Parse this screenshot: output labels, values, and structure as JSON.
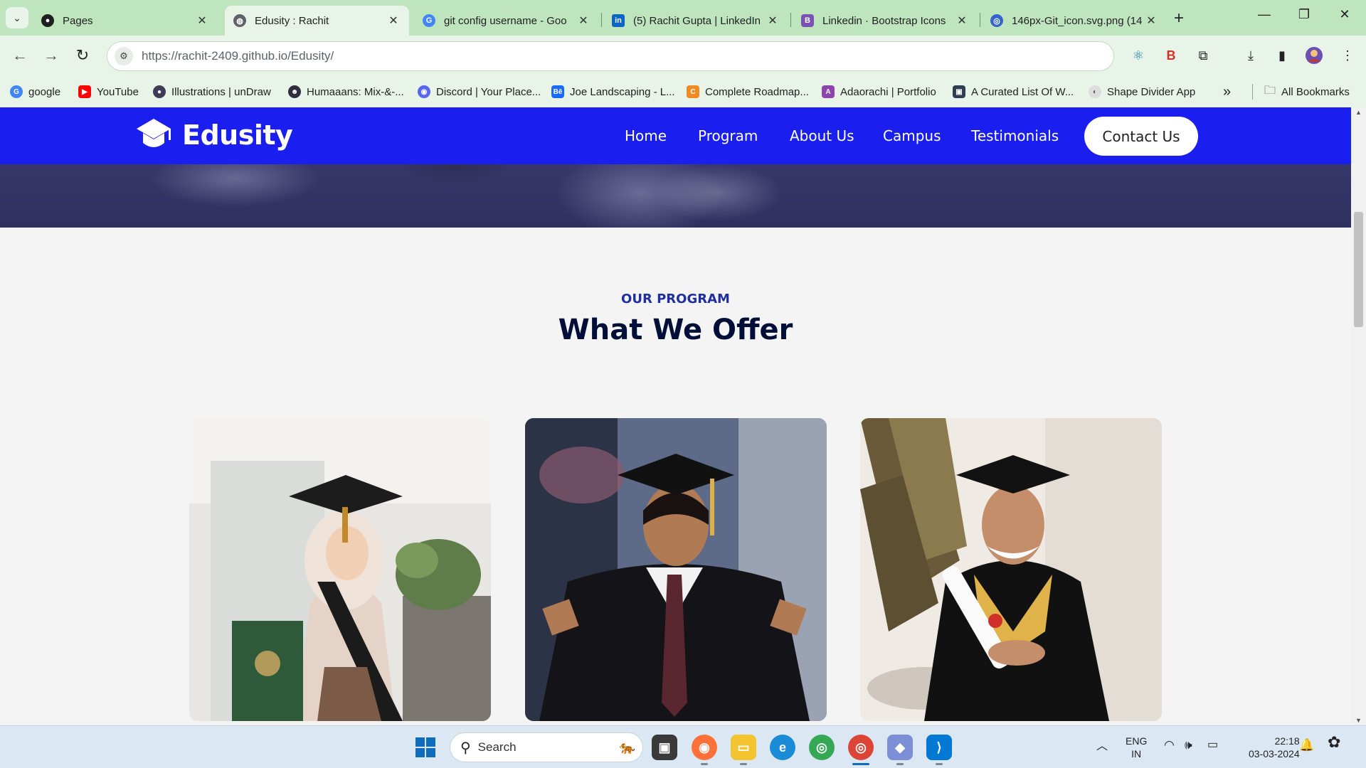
{
  "browser": {
    "tab_list_icon": "chevron-down-icon",
    "tabs": [
      {
        "title": "Pages",
        "icon": "github-icon",
        "color": "#1f1f1f"
      },
      {
        "title": "Edusity : Rachit",
        "icon": "globe-icon",
        "color": "#5f6368"
      },
      {
        "title": "git config username - Goo",
        "icon": "google-icon",
        "color": "#4285f4"
      },
      {
        "title": "(5) Rachit Gupta | LinkedIn",
        "icon": "linkedin-icon",
        "color": "#0a66c2"
      },
      {
        "title": "Linkedin · Bootstrap Icons",
        "icon": "bootstrap-icon",
        "color": "#7952b3"
      },
      {
        "title": "146px-Git_icon.svg.png (14",
        "icon": "wikimedia-icon",
        "color": "#3366cc"
      }
    ],
    "new_tab": "+",
    "window_controls": [
      "—",
      "❐",
      "✕"
    ],
    "url": "https://rachit-2409.github.io/Edusity/",
    "bookmarks": [
      {
        "label": "google",
        "icon": "google-icon",
        "color": "#4285f4"
      },
      {
        "label": "YouTube",
        "icon": "youtube-icon",
        "color": "#ff0000"
      },
      {
        "label": "Illustrations | unDraw",
        "icon": "undraw-icon",
        "color": "#3f3d56"
      },
      {
        "label": "Humaaans: Mix-&-...",
        "icon": "humaaans-icon",
        "color": "#2f2e41"
      },
      {
        "label": "Discord | Your Place...",
        "icon": "discord-icon",
        "color": "#5865f2"
      },
      {
        "label": "Joe Landscaping - L...",
        "icon": "behance-icon",
        "color": "#1769ff"
      },
      {
        "label": "Complete Roadmap...",
        "icon": "codehelp-icon",
        "color": "#f08a24"
      },
      {
        "label": "Adaorachi | Portfolio",
        "icon": "portfolio-icon",
        "color": "#8e44ad"
      },
      {
        "label": "A Curated List Of W...",
        "icon": "list-icon",
        "color": "#2c3e50"
      },
      {
        "label": "Shape Divider App",
        "icon": "shape-icon",
        "color": "#dddddd"
      }
    ],
    "more_bookmarks": "»",
    "all_bookmarks": "All Bookmarks"
  },
  "site": {
    "brand": "Edusity",
    "nav": [
      "Home",
      "Program",
      "About Us",
      "Campus",
      "Testimonials"
    ],
    "cta": "Contact Us",
    "section_subtitle": "OUR PROGRAM",
    "section_title": "What We Offer"
  },
  "taskbar": {
    "search_placeholder": "Search",
    "language": "ENG",
    "region": "IN",
    "time": "22:18",
    "date": "03-03-2024"
  },
  "colors": {
    "nav_blue": "#1a1ff0",
    "subtitle": "#212ea0",
    "heading": "#000f38",
    "chrome_green": "#c9e8c9"
  }
}
